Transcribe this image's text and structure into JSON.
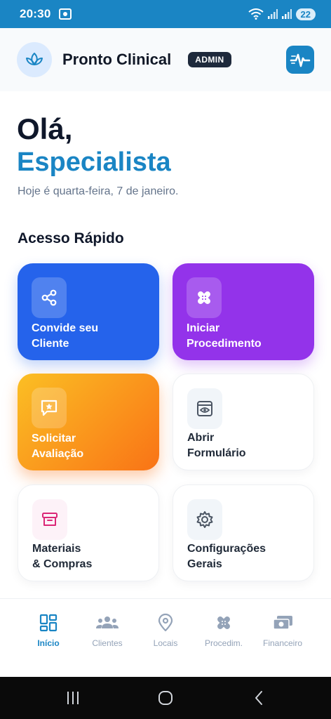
{
  "status": {
    "time": "20:30",
    "battery": "22"
  },
  "header": {
    "title": "Pronto Clinical",
    "badge": "ADMIN"
  },
  "greeting": {
    "line1": "Olá,",
    "name": "Especialista",
    "date": "Hoje é quarta-feira, 7 de janeiro."
  },
  "quick_access": {
    "title": "Acesso Rápido",
    "cards": [
      {
        "label": "Convide seu\nCliente",
        "icon": "share-icon",
        "color": "#2563eb"
      },
      {
        "label": "Iniciar\nProcedimento",
        "icon": "bandage-icon",
        "color": "#9333ea"
      },
      {
        "label": "Solicitar\nAvaliação",
        "icon": "star-message-icon",
        "color": "#f97316"
      },
      {
        "label": "Abrir\nFormulário",
        "icon": "eye-card-icon",
        "color": "#ffffff"
      },
      {
        "label": "Materiais\n& Compras",
        "icon": "archive-icon",
        "color": "#ffffff"
      },
      {
        "label": "Configurações\nGerais",
        "icon": "gear-icon",
        "color": "#ffffff"
      }
    ]
  },
  "nav": {
    "items": [
      {
        "label": "Início",
        "icon": "grid-icon",
        "active": true
      },
      {
        "label": "Clientes",
        "icon": "users-icon"
      },
      {
        "label": "Locais",
        "icon": "map-pin-icon"
      },
      {
        "label": "Procedim.",
        "icon": "bandage-icon"
      },
      {
        "label": "Financeiro",
        "icon": "money-icon"
      }
    ]
  },
  "colors": {
    "primary": "#1a85c4",
    "blue": "#2563eb",
    "purple": "#9333ea",
    "orange": "#f97316",
    "dark": "#1e293b"
  }
}
